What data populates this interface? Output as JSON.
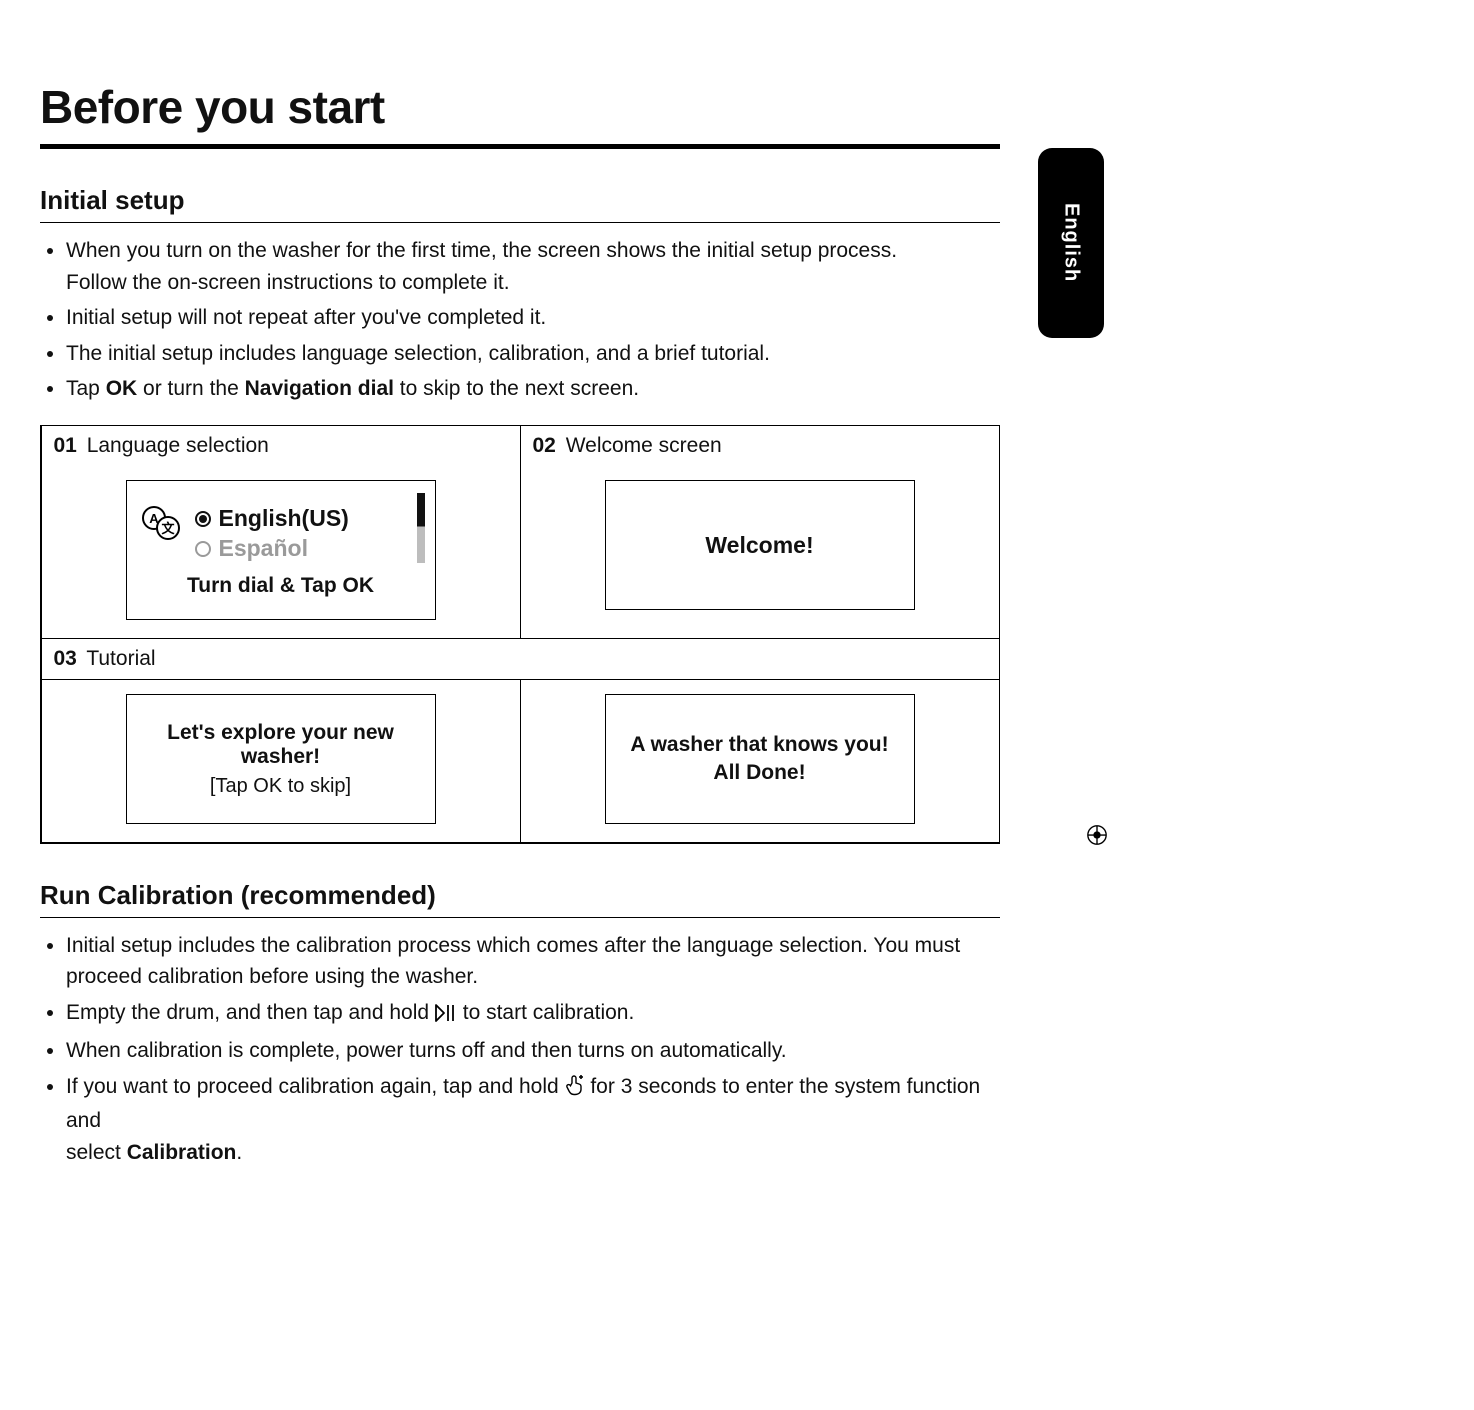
{
  "page_title": "Before you start",
  "side_tab_label": "English",
  "sections": {
    "initial_setup": {
      "heading": "Initial setup",
      "bullets": {
        "b1a": "When you turn on the washer for the first time, the screen shows the initial setup process.",
        "b1b": "Follow the on-screen instructions to complete it.",
        "b2": "Initial setup will not repeat after you've completed it.",
        "b3": "The initial setup includes language selection, calibration, and a brief tutorial.",
        "b4_pre": "Tap ",
        "b4_ok": "OK",
        "b4_mid": " or turn the ",
        "b4_nav": "Navigation dial",
        "b4_post": " to skip to the next screen."
      }
    },
    "run_calibration": {
      "heading": "Run Calibration (recommended)",
      "bullets": {
        "c1a": "Initial setup includes the calibration process which comes after the language selection. You must",
        "c1b": "proceed calibration before using the washer.",
        "c2_pre": "Empty the drum, and then tap and hold ",
        "c2_post": " to start calibration.",
        "c3": "When calibration is complete, power turns off and then turns on automatically.",
        "c4_pre": "If you want to proceed calibration again, tap and hold ",
        "c4_mid": " for 3 seconds to enter the system function and",
        "c4_post": "select ",
        "c4_cal": "Calibration",
        "c4_end": "."
      }
    }
  },
  "figure": {
    "cell01_num": "01",
    "cell01_label": "Language selection",
    "cell02_num": "02",
    "cell02_label": "Welcome screen",
    "cell03_num": "03",
    "cell03_label": "Tutorial",
    "screen_lang_opt1": "English(US)",
    "screen_lang_opt2": "Español",
    "screen_lang_instr": "Turn dial & Tap OK",
    "screen_welcome": "Welcome!",
    "screen_tut1_line1": "Let's explore your new washer!",
    "screen_tut1_line2": "[Tap OK to skip]",
    "screen_tut2_line1": "A washer that knows you!",
    "screen_tut2_line2": "All Done!"
  }
}
